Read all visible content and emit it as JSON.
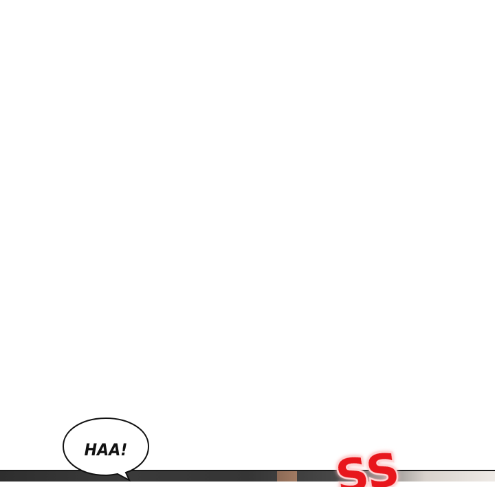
{
  "speech_bubble": {
    "text": "HAA!"
  },
  "sound_effect": {
    "text": "SS",
    "color": "#e8141c",
    "glow_color": "#ff4a4a"
  },
  "colors": {
    "background": "#ffffff",
    "bubble_outline": "#111111",
    "panel_dark": "#353535"
  }
}
